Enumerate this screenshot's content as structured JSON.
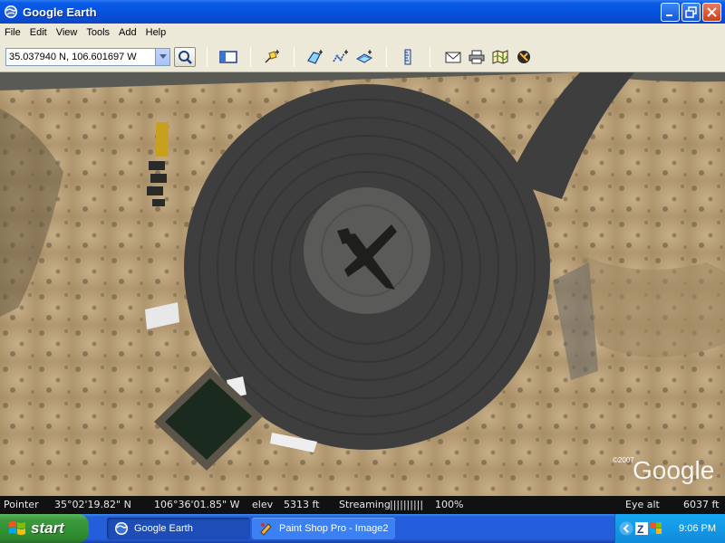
{
  "window": {
    "title": "Google Earth",
    "controls": [
      "minimize",
      "restore",
      "close"
    ]
  },
  "menu": {
    "items": [
      {
        "label": "File"
      },
      {
        "label": "Edit"
      },
      {
        "label": "View"
      },
      {
        "label": "Tools"
      },
      {
        "label": "Add"
      },
      {
        "label": "Help"
      }
    ]
  },
  "toolbar": {
    "location_value": "35.037940 N, 106.601697 W",
    "icons": [
      "search-icon",
      "sidebar-icon",
      "placemark-icon",
      "polygon-icon",
      "path-icon",
      "image-overlay-icon",
      "ruler-icon",
      "email-icon",
      "print-icon",
      "maps-icon",
      "sky-icon"
    ]
  },
  "map": {
    "copyright": "©2007",
    "watermark": "Google"
  },
  "status": {
    "pointer_label": "Pointer",
    "lat": "35°02'19.82\" N",
    "lon": "106°36'01.85\" W",
    "elev_label": "elev",
    "elev_value": "5313 ft",
    "streaming_label": "Streaming",
    "streaming_bars": "||||||||||",
    "streaming_percent": "100%",
    "eye_alt_label": "Eye alt",
    "eye_alt_value": "6037 ft",
    "streaming_progress": 1.0
  },
  "taskbar": {
    "start_label": "start",
    "tasks": [
      {
        "label": "Google Earth",
        "active": true
      },
      {
        "label": "Paint Shop Pro - Image2",
        "active": false
      }
    ],
    "clock": "9:06 PM"
  },
  "colors": {
    "titlebar": "#0650dc",
    "taskbar": "#245edb",
    "start": "#3c9a3c",
    "tarmac": "#3e3e3e",
    "desert": "#b8a07a"
  }
}
